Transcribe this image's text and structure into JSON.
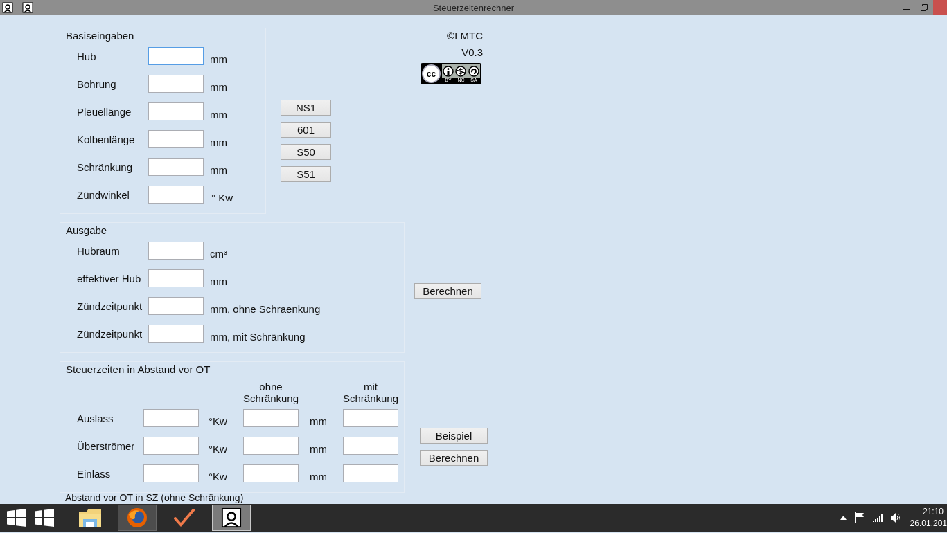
{
  "window": {
    "title": "Steuerzeitenrechner"
  },
  "basiseingaben": {
    "title": "Basiseingaben",
    "rows": [
      {
        "label": "Hub",
        "unit": "mm",
        "focused": true
      },
      {
        "label": "Bohrung",
        "unit": "mm",
        "focused": false
      },
      {
        "label": "Pleuellänge",
        "unit": "mm",
        "focused": false
      },
      {
        "label": "Kolbenlänge",
        "unit": "mm",
        "focused": false
      },
      {
        "label": "Schränkung",
        "unit": "mm",
        "focused": false
      },
      {
        "label": "Zündwinkel",
        "unit": "° Kw",
        "focused": false
      }
    ]
  },
  "presets": [
    "NS1",
    "601",
    "S50",
    "S51"
  ],
  "info": {
    "copyright": "©LMTC",
    "version": "V0.3",
    "license_badge": {
      "mark": "cc",
      "labels": [
        "BY",
        "NC",
        "SA"
      ]
    }
  },
  "ausgabe": {
    "title": "Ausgabe",
    "rows": [
      {
        "label": "Hubraum",
        "unit": "cm³"
      },
      {
        "label": "effektiver Hub",
        "unit": "mm"
      },
      {
        "label": "Zündzeitpunkt",
        "unit": "mm, ohne Schraenkung"
      },
      {
        "label": "Zündzeitpunkt",
        "unit": "mm, mit Schränkung"
      }
    ],
    "button": "Berechnen"
  },
  "steuerzeiten": {
    "title": "Steuerzeiten in Abstand vor OT",
    "columns": [
      "ohne Schränkung",
      "mit Schränkung"
    ],
    "rows": [
      {
        "label": "Auslass",
        "unit_1": "°Kw",
        "unit_2": "mm"
      },
      {
        "label": "Überströmer",
        "unit_1": "°Kw",
        "unit_2": "mm"
      },
      {
        "label": "Einlass",
        "unit_1": "°Kw",
        "unit_2": "mm"
      }
    ],
    "buttons": [
      "Beispiel",
      "Berechnen"
    ]
  },
  "next_section": {
    "title": "Abstand vor OT in SZ (ohne Schränkung)"
  },
  "taskbar": {
    "apps": [
      {
        "kind": "explorer",
        "running": false,
        "selected": false
      },
      {
        "kind": "browser",
        "running": true,
        "selected": false
      },
      {
        "kind": "check",
        "running": false,
        "selected": false
      },
      {
        "kind": "frame",
        "running": true,
        "selected": true
      }
    ],
    "clock": {
      "time": "21:10",
      "date": "26.01.201"
    }
  }
}
